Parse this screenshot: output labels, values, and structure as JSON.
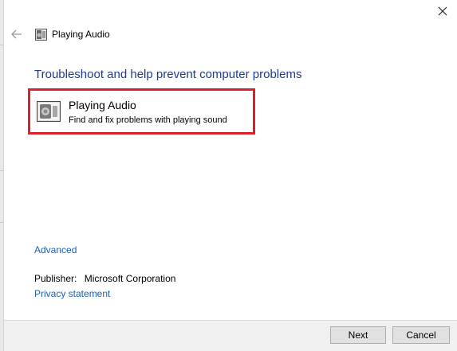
{
  "window": {
    "title": "Playing Audio"
  },
  "heading": "Troubleshoot and help prevent computer problems",
  "troubleshooter": {
    "title": "Playing Audio",
    "description": "Find and fix problems with playing sound",
    "icon": "speaker-icon"
  },
  "links": {
    "advanced": "Advanced",
    "privacy": "Privacy statement"
  },
  "publisher": {
    "label": "Publisher:",
    "value": "Microsoft Corporation"
  },
  "buttons": {
    "next": "Next",
    "cancel": "Cancel"
  },
  "colors": {
    "heading": "#1e3c8c",
    "link": "#1a5fb4",
    "highlight_border": "#dd1f2b"
  }
}
